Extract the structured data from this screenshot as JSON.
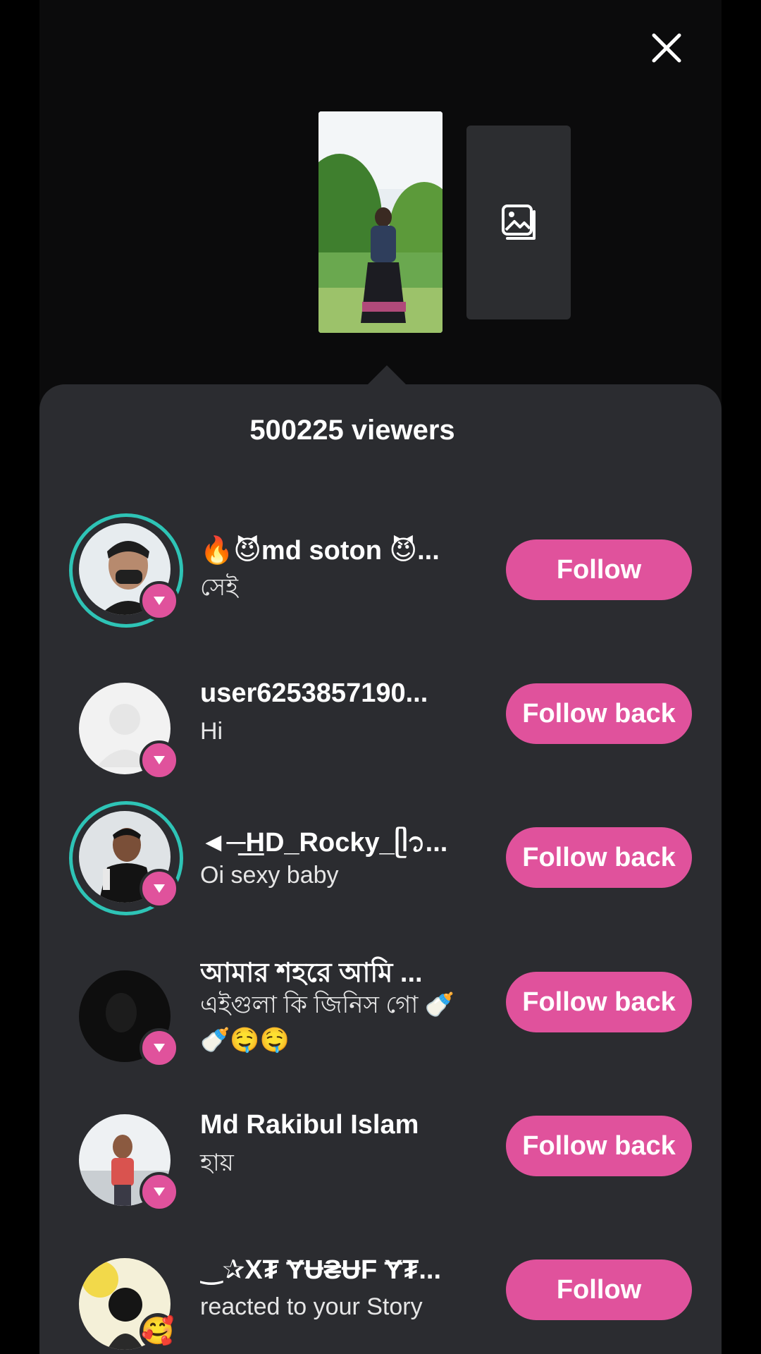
{
  "header": {
    "close_icon": "close-icon"
  },
  "story": {
    "placeholder_icon": "image-stack-icon"
  },
  "viewers": {
    "count_label": "500225 viewers",
    "items": [
      {
        "name": "🔥😈md soton 😈...",
        "message": "সেই",
        "button": "Follow",
        "has_story_ring": true,
        "badge": "reply"
      },
      {
        "name": "user6253857190...",
        "message": "Hi",
        "button": "Follow back",
        "has_story_ring": false,
        "badge": "reply"
      },
      {
        "name": "◄─͟HD_Rocky_ᥫ᭡...",
        "message": "Oi sexy baby",
        "button": "Follow back",
        "has_story_ring": true,
        "badge": "reply"
      },
      {
        "name": "আমার শহরে আমি ...",
        "message": "এইগুলা কি জিনিস গো 🍼🍼🤤🤤",
        "button": "Follow back",
        "has_story_ring": false,
        "badge": "reply"
      },
      {
        "name": "Md Rakibul Islam",
        "message": "হায়",
        "button": "Follow back",
        "has_story_ring": false,
        "badge": "reply"
      },
      {
        "name": "‿✰X₮ ɎɄ₴ɄF Ɏ₮...",
        "message": "reacted to your Story",
        "button": "Follow",
        "has_story_ring": false,
        "badge": "🥰"
      }
    ]
  },
  "colors": {
    "accent": "#e0529c",
    "ring": "#2ec4b6",
    "sheet": "#2b2c30",
    "background": "#0b0b0c"
  }
}
